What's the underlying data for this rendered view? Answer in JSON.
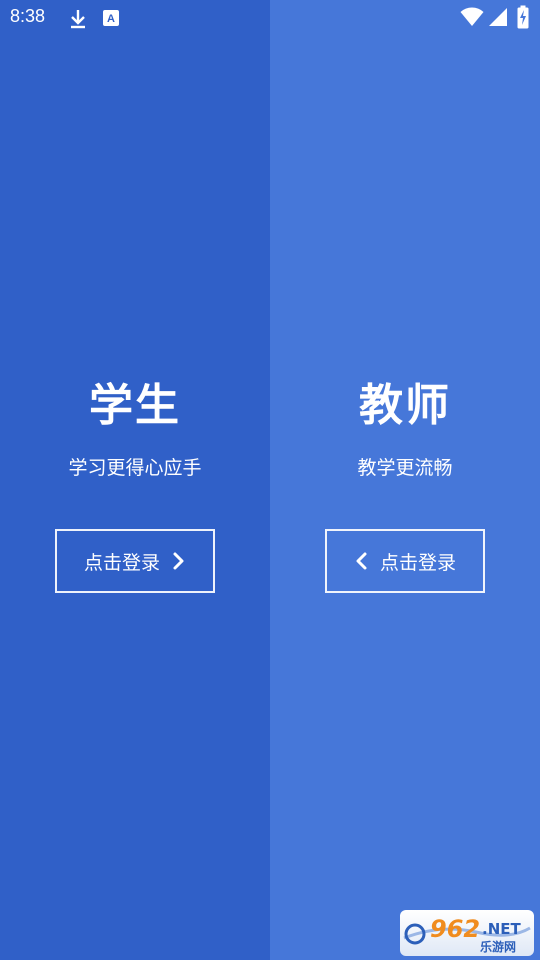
{
  "status_bar": {
    "time": "8:38",
    "icons": [
      "download-icon",
      "keyboard-a-icon",
      "wifi-icon",
      "cellular-signal-icon",
      "battery-charging-icon"
    ]
  },
  "student": {
    "title": "学生",
    "subtitle": "学习更得心应手",
    "button_label": "点击登录"
  },
  "teacher": {
    "title": "教师",
    "subtitle": "教学更流畅",
    "button_label": "点击登录"
  },
  "watermark": {
    "brand": "962.NET",
    "sub": "乐游网"
  },
  "colors": {
    "student_bg": "#3060c8",
    "teacher_bg": "#4677d9",
    "text": "#ffffff"
  }
}
